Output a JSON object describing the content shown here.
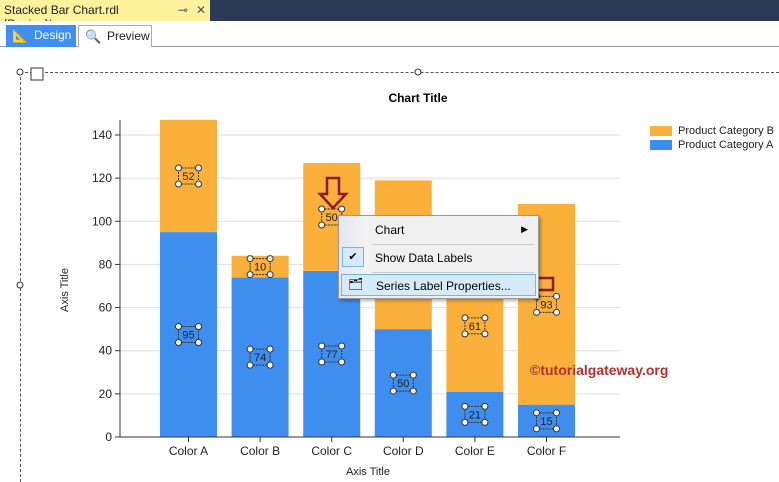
{
  "document_tab": {
    "title": "Stacked Bar Chart.rdl [Design]*",
    "pin": "⊸",
    "close": "✕"
  },
  "tabs": [
    {
      "label": "Design",
      "icon": "design-icon"
    },
    {
      "label": "Preview",
      "icon": "preview-icon"
    }
  ],
  "context_menu": {
    "items": [
      "Chart",
      "Show Data Labels",
      "Series Label Properties..."
    ]
  },
  "watermark": "©tutorialgateway.org",
  "colors": {
    "series_a": "#3e8ef0",
    "series_b": "#fbb03b",
    "accent": "#3e8ef5"
  },
  "chart_data": {
    "type": "bar",
    "stacked": true,
    "title": "Chart Title",
    "xlabel": "Axis Title",
    "ylabel": "Axis Title",
    "categories": [
      "Color A",
      "Color B",
      "Color C",
      "Color D",
      "Color E",
      "Color F"
    ],
    "series": [
      {
        "name": "Product Category A",
        "values": [
          95,
          74,
          77,
          50,
          21,
          15
        ],
        "labels": [
          "95",
          "74",
          "77",
          "50",
          "21",
          "15"
        ]
      },
      {
        "name": "Product Category B",
        "values": [
          52,
          10,
          50,
          69,
          61,
          93
        ],
        "labels": [
          "52",
          "10",
          "50",
          "",
          "61",
          "93"
        ]
      }
    ],
    "ylim": [
      0,
      147
    ],
    "yticks": [
      0,
      20,
      40,
      60,
      80,
      100,
      120,
      140
    ],
    "grid": true,
    "legend": "top-right"
  }
}
